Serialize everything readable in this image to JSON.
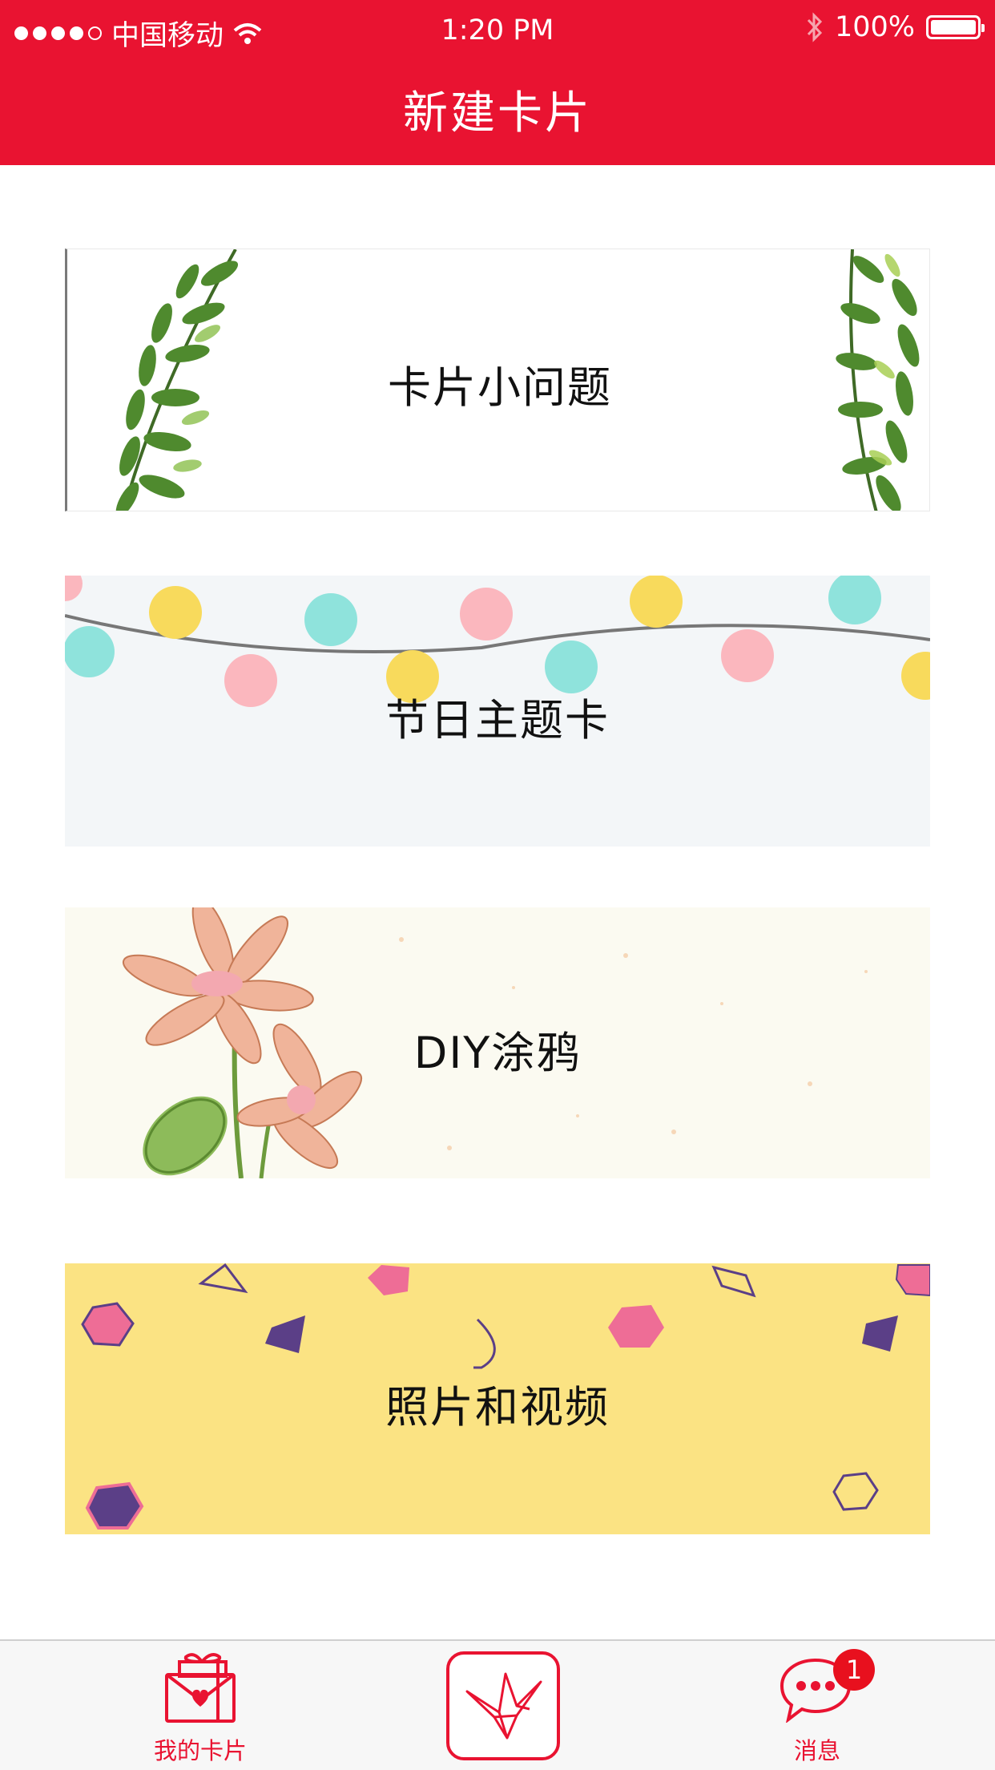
{
  "status_bar": {
    "carrier": "中国移动",
    "time": "1:20 PM",
    "battery": "100%"
  },
  "header": {
    "title": "新建卡片"
  },
  "cards": [
    {
      "label": "卡片小问题"
    },
    {
      "label": "节日主题卡"
    },
    {
      "label": "DIY涂鸦"
    },
    {
      "label": "照片和视频"
    }
  ],
  "tabbar": {
    "tabs": [
      {
        "label": "我的卡片",
        "icon": "gift-card-icon"
      },
      {
        "label": "",
        "icon": "paper-crane-icon"
      },
      {
        "label": "消息",
        "icon": "chat-bubble-icon",
        "badge": "1"
      }
    ]
  },
  "colors": {
    "brand_red": "#e91331",
    "card2_bg": "#f3f6f8",
    "card3_bg": "#fbfaf1",
    "card4_bg": "#fbe383"
  }
}
